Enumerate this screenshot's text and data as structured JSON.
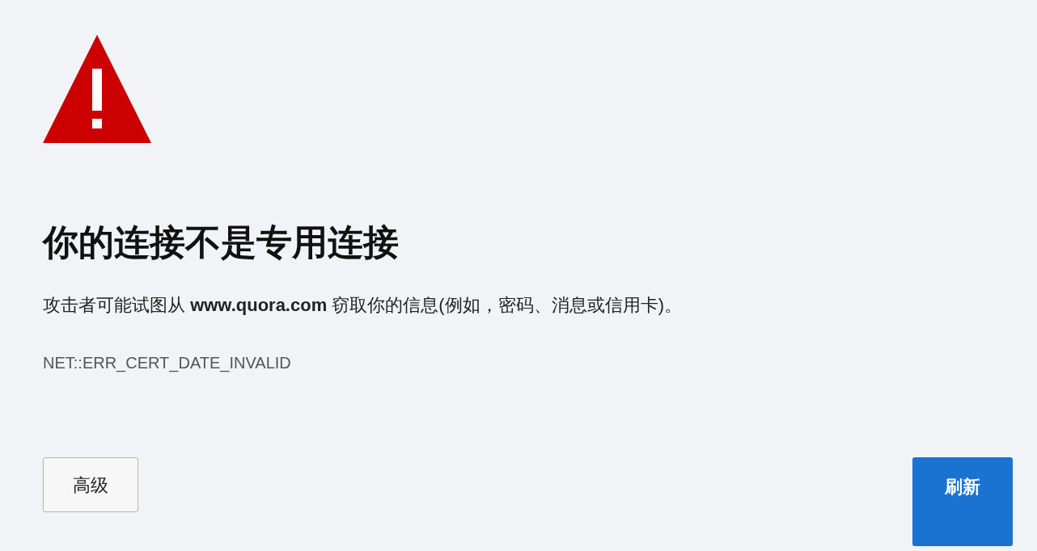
{
  "title": "你的连接不是专用连接",
  "description": "攻击者可能试图从 **www.quora.com** 窃取你的信息(例如，密码、消息或信用卡)。",
  "error_code": "NET::ERR_CERT_DATE_INVALID",
  "buttons": [
    {
      "label": "高级",
      "kind": "secondary"
    },
    {
      "label": "刷新",
      "kind": "primary"
    }
  ]
}
